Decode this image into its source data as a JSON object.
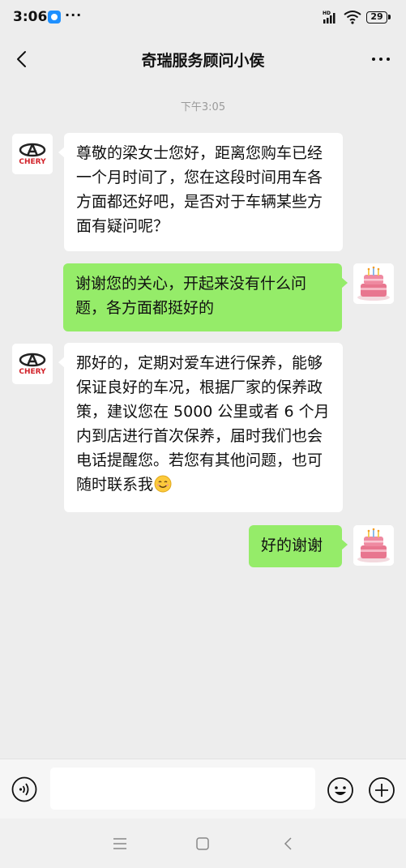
{
  "status_bar": {
    "time": "3:06",
    "dots": "···",
    "network": "HD",
    "battery": "29"
  },
  "header": {
    "title": "奇瑞服务顾问小侯"
  },
  "timestamp": "下午3:05",
  "messages": [
    {
      "from": "agent",
      "avatar": "chery-logo",
      "text": "尊敬的梁女士您好，距离您购车已经一个月时间了，您在这段时间用车各方面都还好吧，是否对于车辆某些方面有疑问呢？"
    },
    {
      "from": "user",
      "avatar": "cake",
      "text": "谢谢您的关心，开起来没有什么问题，各方面都挺好的"
    },
    {
      "from": "agent",
      "avatar": "chery-logo",
      "text": "那好的，定期对爱车进行保养，能够保证良好的车况，根据厂家的保养政策，建议您在 5000 公里或者 6 个月内到店进行首次保养，届时我们也会电话提醒您。若您有其他问题，也可随时联系我",
      "emoji": "smiling-face"
    },
    {
      "from": "user",
      "avatar": "cake",
      "text": "好的谢谢"
    }
  ],
  "chery_logo_text": "CHERY",
  "input": {
    "value": "",
    "placeholder": ""
  },
  "colors": {
    "background": "#ededed",
    "outgoing_bubble": "#95ec69",
    "incoming_bubble": "#ffffff",
    "chery_red": "#d2232a"
  }
}
